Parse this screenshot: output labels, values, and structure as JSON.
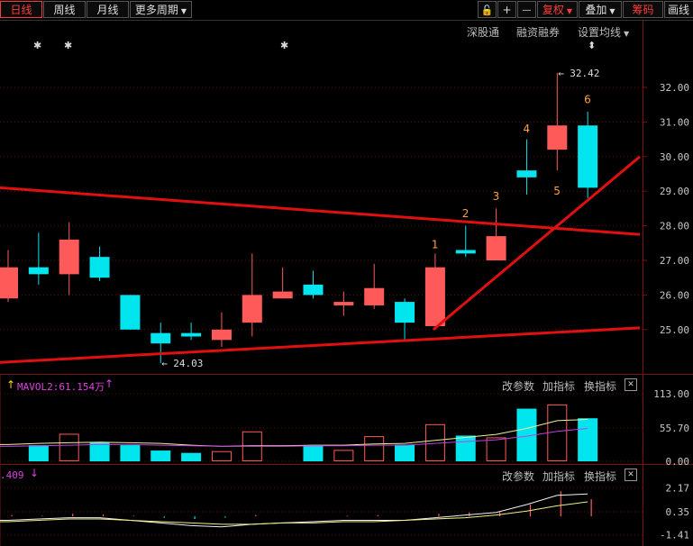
{
  "toolbar": {
    "periods": [
      "日线",
      "周线",
      "月线",
      "更多周期"
    ],
    "lock_glyph": "🔓",
    "plus_glyph": "+",
    "minus_glyph": "—",
    "fuquan": "复权",
    "overlay": "叠加",
    "chips": "筹码",
    "huijiao": "画线"
  },
  "main_panel": {
    "links": [
      "深股通",
      "融资融券",
      "设置均线"
    ],
    "star_glyph": "✱",
    "high_marker": "32.42",
    "low_marker": "24.03",
    "price_ticks": [
      "32.00",
      "31.00",
      "30.00",
      "29.00",
      "28.00",
      "27.00",
      "26.00",
      "25.00"
    ],
    "count_labels": [
      "1",
      "2",
      "3",
      "4",
      "5",
      "6"
    ]
  },
  "volume_panel": {
    "indicator": "MAVOL2:61.154万",
    "buttons": [
      "改参数",
      "加指标",
      "换指标"
    ],
    "close_glyph": "✕",
    "ticks": [
      "113.00",
      "55.70",
      "0.00"
    ]
  },
  "macd_panel": {
    "indicator_value": ".409",
    "buttons": [
      "改参数",
      "加指标",
      "换指标"
    ],
    "close_glyph": "✕",
    "ticks": [
      "2.17",
      "0.35",
      "-1.41"
    ]
  },
  "colors": {
    "up": "#ff5a5a",
    "down": "#00e5ee",
    "trend": "#e01010"
  },
  "chart_data": {
    "type": "candlestick",
    "candles": [
      {
        "o": 25.9,
        "c": 26.8,
        "h": 27.3,
        "l": 25.8
      },
      {
        "o": 26.8,
        "c": 26.6,
        "h": 27.8,
        "l": 26.3
      },
      {
        "o": 26.6,
        "c": 27.6,
        "h": 28.1,
        "l": 26.0
      },
      {
        "o": 27.1,
        "c": 26.5,
        "h": 27.4,
        "l": 26.4
      },
      {
        "o": 26.0,
        "c": 25.0,
        "h": 26.0,
        "l": 25.0
      },
      {
        "o": 24.9,
        "c": 24.6,
        "h": 25.2,
        "l": 24.03
      },
      {
        "o": 24.9,
        "c": 24.8,
        "h": 25.2,
        "l": 24.7
      },
      {
        "o": 24.7,
        "c": 25.0,
        "h": 25.5,
        "l": 24.5
      },
      {
        "o": 25.2,
        "c": 26.0,
        "h": 27.2,
        "l": 24.8
      },
      {
        "o": 25.9,
        "c": 26.1,
        "h": 26.8,
        "l": 25.9
      },
      {
        "o": 26.3,
        "c": 26.0,
        "h": 26.7,
        "l": 25.9
      },
      {
        "o": 25.7,
        "c": 25.8,
        "h": 26.1,
        "l": 25.4
      },
      {
        "o": 25.7,
        "c": 26.2,
        "h": 26.9,
        "l": 25.6
      },
      {
        "o": 25.8,
        "c": 25.2,
        "h": 25.9,
        "l": 24.7
      },
      {
        "o": 25.1,
        "c": 26.8,
        "h": 27.2,
        "l": 25.1
      },
      {
        "o": 27.3,
        "c": 27.2,
        "h": 28.0,
        "l": 27.1
      },
      {
        "o": 27.0,
        "c": 27.7,
        "h": 28.5,
        "l": 27.0
      },
      {
        "o": 29.6,
        "c": 29.4,
        "h": 30.5,
        "l": 28.9
      },
      {
        "o": 30.2,
        "c": 30.9,
        "h": 32.42,
        "l": 29.6
      },
      {
        "o": 30.9,
        "c": 29.1,
        "h": 31.3,
        "l": 28.8
      }
    ],
    "volume": [
      0,
      27,
      46,
      32,
      27,
      18,
      14,
      17,
      50,
      0,
      27,
      19,
      42,
      28,
      62,
      43,
      40,
      88,
      95,
      72
    ],
    "vol_ma_a": [
      28,
      30,
      31,
      32,
      31,
      30,
      27,
      25,
      26,
      26,
      27,
      27,
      29,
      30,
      35,
      40,
      45,
      55,
      68,
      70
    ],
    "vol_ma_b": [
      25,
      26,
      27,
      28,
      28,
      27,
      26,
      25,
      25,
      25,
      26,
      26,
      27,
      27,
      30,
      33,
      36,
      42,
      50,
      55
    ],
    "macd_hist": [
      0.1,
      0.05,
      0.2,
      0.15,
      0.05,
      -0.1,
      -0.2,
      -0.1,
      0.1,
      0.0,
      0.0,
      0.05,
      0.1,
      0.0,
      0.2,
      0.3,
      0.4,
      0.9,
      1.9,
      1.3
    ],
    "macd_dif": [
      -0.3,
      -0.2,
      -0.1,
      -0.1,
      -0.3,
      -0.5,
      -0.7,
      -0.8,
      -0.6,
      -0.5,
      -0.4,
      -0.3,
      -0.3,
      -0.3,
      -0.1,
      0.1,
      0.3,
      0.9,
      1.6,
      1.7
    ],
    "macd_dea": [
      -0.4,
      -0.3,
      -0.2,
      -0.2,
      -0.3,
      -0.4,
      -0.5,
      -0.6,
      -0.6,
      -0.5,
      -0.5,
      -0.4,
      -0.4,
      -0.3,
      -0.2,
      -0.1,
      0.1,
      0.4,
      0.8,
      1.1
    ]
  }
}
